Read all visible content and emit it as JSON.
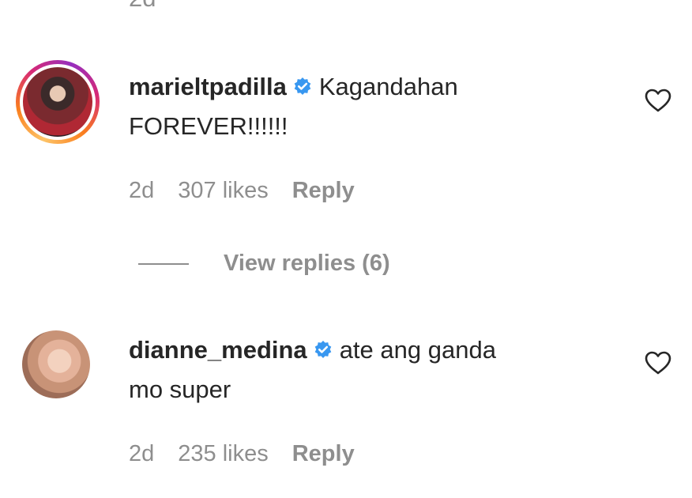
{
  "previous": {
    "time": "2d"
  },
  "comments": [
    {
      "username": "marieltpadilla",
      "text_line1": "Kagandahan",
      "text_line2": "FOREVER!!!!!!",
      "time": "2d",
      "likes": "307 likes",
      "reply": "Reply",
      "view_replies": "View replies (6)"
    },
    {
      "username": "dianne_medina",
      "text_line1": "ate ang ganda",
      "text_line2": "mo super",
      "time": "2d",
      "likes": "235 likes",
      "reply": "Reply"
    }
  ],
  "colors": {
    "verified": "#3897f0",
    "secondary_text": "#8e8e8e",
    "primary_text": "#262626"
  },
  "icons": {
    "verified": "verified-badge-icon",
    "like": "heart-outline-icon"
  }
}
